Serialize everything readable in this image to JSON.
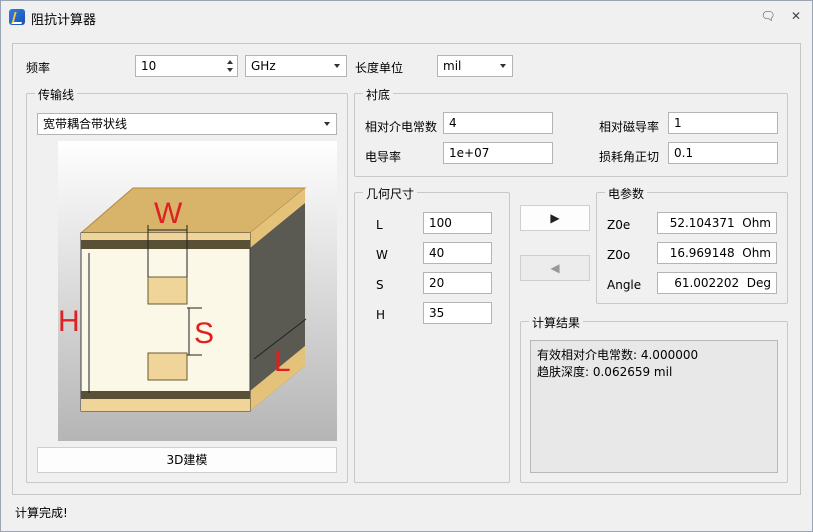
{
  "window": {
    "title": "阻抗计算器",
    "minimize_glyph": "🗨",
    "close_glyph": "✕"
  },
  "top": {
    "freq_label": "频率",
    "freq_value": "10",
    "freq_unit": "GHz",
    "length_unit_label": "长度单位",
    "length_unit": "mil"
  },
  "line": {
    "group_title": "传输线",
    "type": "宽带耦合带状线",
    "build_button": "3D建模",
    "figure_labels": {
      "W": "W",
      "S": "S",
      "H": "H",
      "L": "L"
    }
  },
  "substrate": {
    "group_title": "衬底",
    "er_label": "相对介电常数",
    "er_value": "4",
    "ur_label": "相对磁导率",
    "ur_value": "1",
    "sigma_label": "电导率",
    "sigma_value": "1e+07",
    "tand_label": "损耗角正切",
    "tand_value": "0.1"
  },
  "geometry": {
    "group_title": "几何尺寸",
    "rows": [
      {
        "label": "L",
        "value": "100"
      },
      {
        "label": "W",
        "value": "40"
      },
      {
        "label": "S",
        "value": "20"
      },
      {
        "label": "H",
        "value": "35"
      }
    ]
  },
  "actions": {
    "forward_glyph": "▶",
    "back_glyph": "◀"
  },
  "electrical": {
    "group_title": "电参数",
    "rows": [
      {
        "label": "Z0e",
        "value": "52.104371",
        "unit": "Ohm"
      },
      {
        "label": "Z0o",
        "value": "16.969148",
        "unit": "Ohm"
      },
      {
        "label": "Angle",
        "value": "61.002202",
        "unit": "Deg"
      }
    ]
  },
  "results": {
    "group_title": "计算结果",
    "line1": "有效相对介电常数: 4.000000",
    "line2": "趋肤深度: 0.062659 mil"
  },
  "status": "计算完成!",
  "colors": {
    "figure_red": "#e02020",
    "copper": "#f0d59a",
    "substrate_top": "#d8b36a",
    "side": "#5a5a52"
  }
}
